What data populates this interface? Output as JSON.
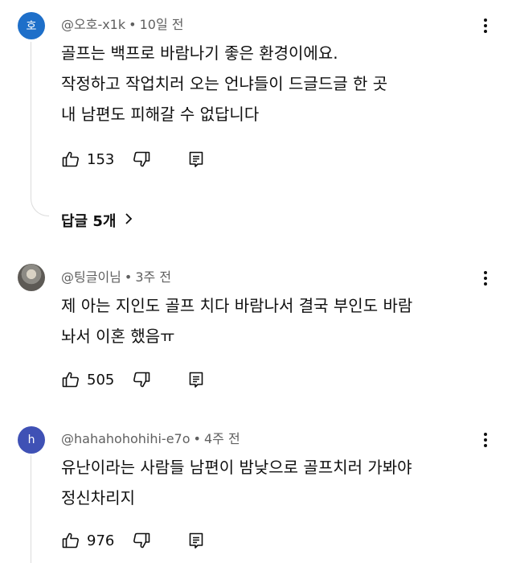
{
  "comments": [
    {
      "avatar_letter": "호",
      "avatar_color": "#1e6fc9",
      "author": "@오호-x1k",
      "time": "10일 전",
      "lines": [
        "골프는 백프로 바람나기 좋은 환경이에요.",
        "작정하고 작업치러 오는 언냐들이 드글드글 한 곳",
        "내 남편도 피해갈 수 없답니다"
      ],
      "likes": "153",
      "replies_label": "답글 5개"
    },
    {
      "avatar_letter": "",
      "author": "@팅글이님",
      "time": "3주 전",
      "lines": [
        "제 아는 지인도 골프 치다 바람나서 결국 부인도 바람",
        "놔서 이혼 했음ㅠ"
      ],
      "likes": "505"
    },
    {
      "avatar_letter": "h",
      "avatar_color": "#3f51b5",
      "author": "@hahahohohihi-e7o",
      "time": "4주 전",
      "lines": [
        "유난이라는 사람들 남편이 밤낮으로 골프치러 가봐야",
        "정신차리지"
      ],
      "likes": "976"
    }
  ],
  "separator": "•",
  "icons": {
    "like": "thumb-up-icon",
    "dislike": "thumb-down-icon",
    "reply": "reply-comment-icon",
    "menu": "more-vertical-icon",
    "chevron": "chevron-right-icon"
  }
}
